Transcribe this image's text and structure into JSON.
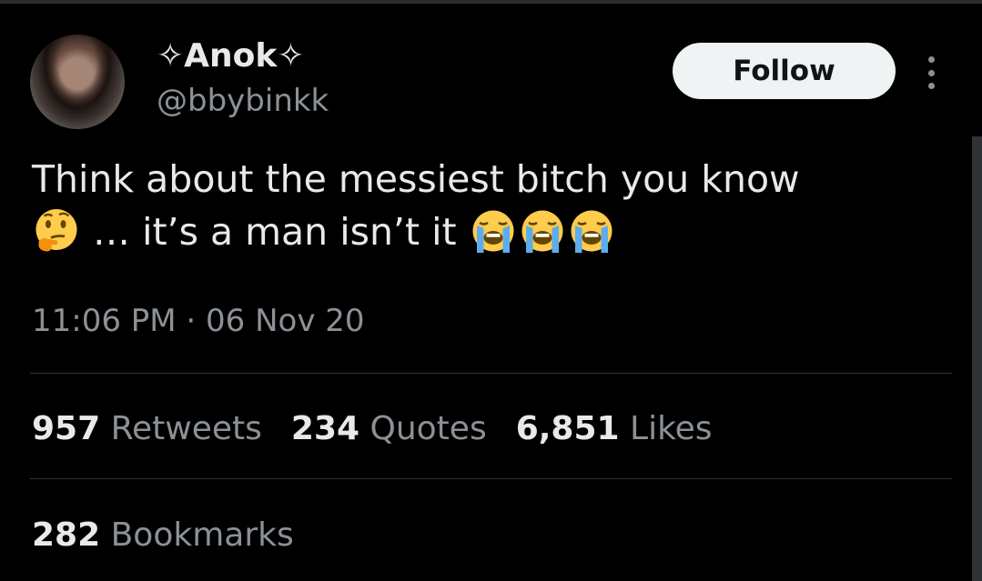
{
  "author": {
    "name": "✧Anok✧",
    "handle": "@bbybinkk"
  },
  "follow_button": {
    "label": "Follow"
  },
  "tweet": {
    "text_line1": "Think about the messiest bitch you know",
    "text_line2": " … it’s a man isn’t it ",
    "timestamp": "11:06 PM · 06 Nov 20"
  },
  "stats": {
    "retweets": {
      "count": "957",
      "label": "Retweets"
    },
    "quotes": {
      "count": "234",
      "label": "Quotes"
    },
    "likes": {
      "count": "6,851",
      "label": "Likes"
    },
    "bookmarks": {
      "count": "282",
      "label": "Bookmarks"
    }
  },
  "icons": {
    "thinking": "thinking-face-emoji",
    "crying": "loudly-crying-face-emoji",
    "more": "more-options-icon"
  },
  "colors": {
    "background": "#000000",
    "primary_text": "#e7e9ea",
    "secondary_text": "#8b9196",
    "divider": "#2f3336",
    "follow_bg": "#eff3f4"
  }
}
